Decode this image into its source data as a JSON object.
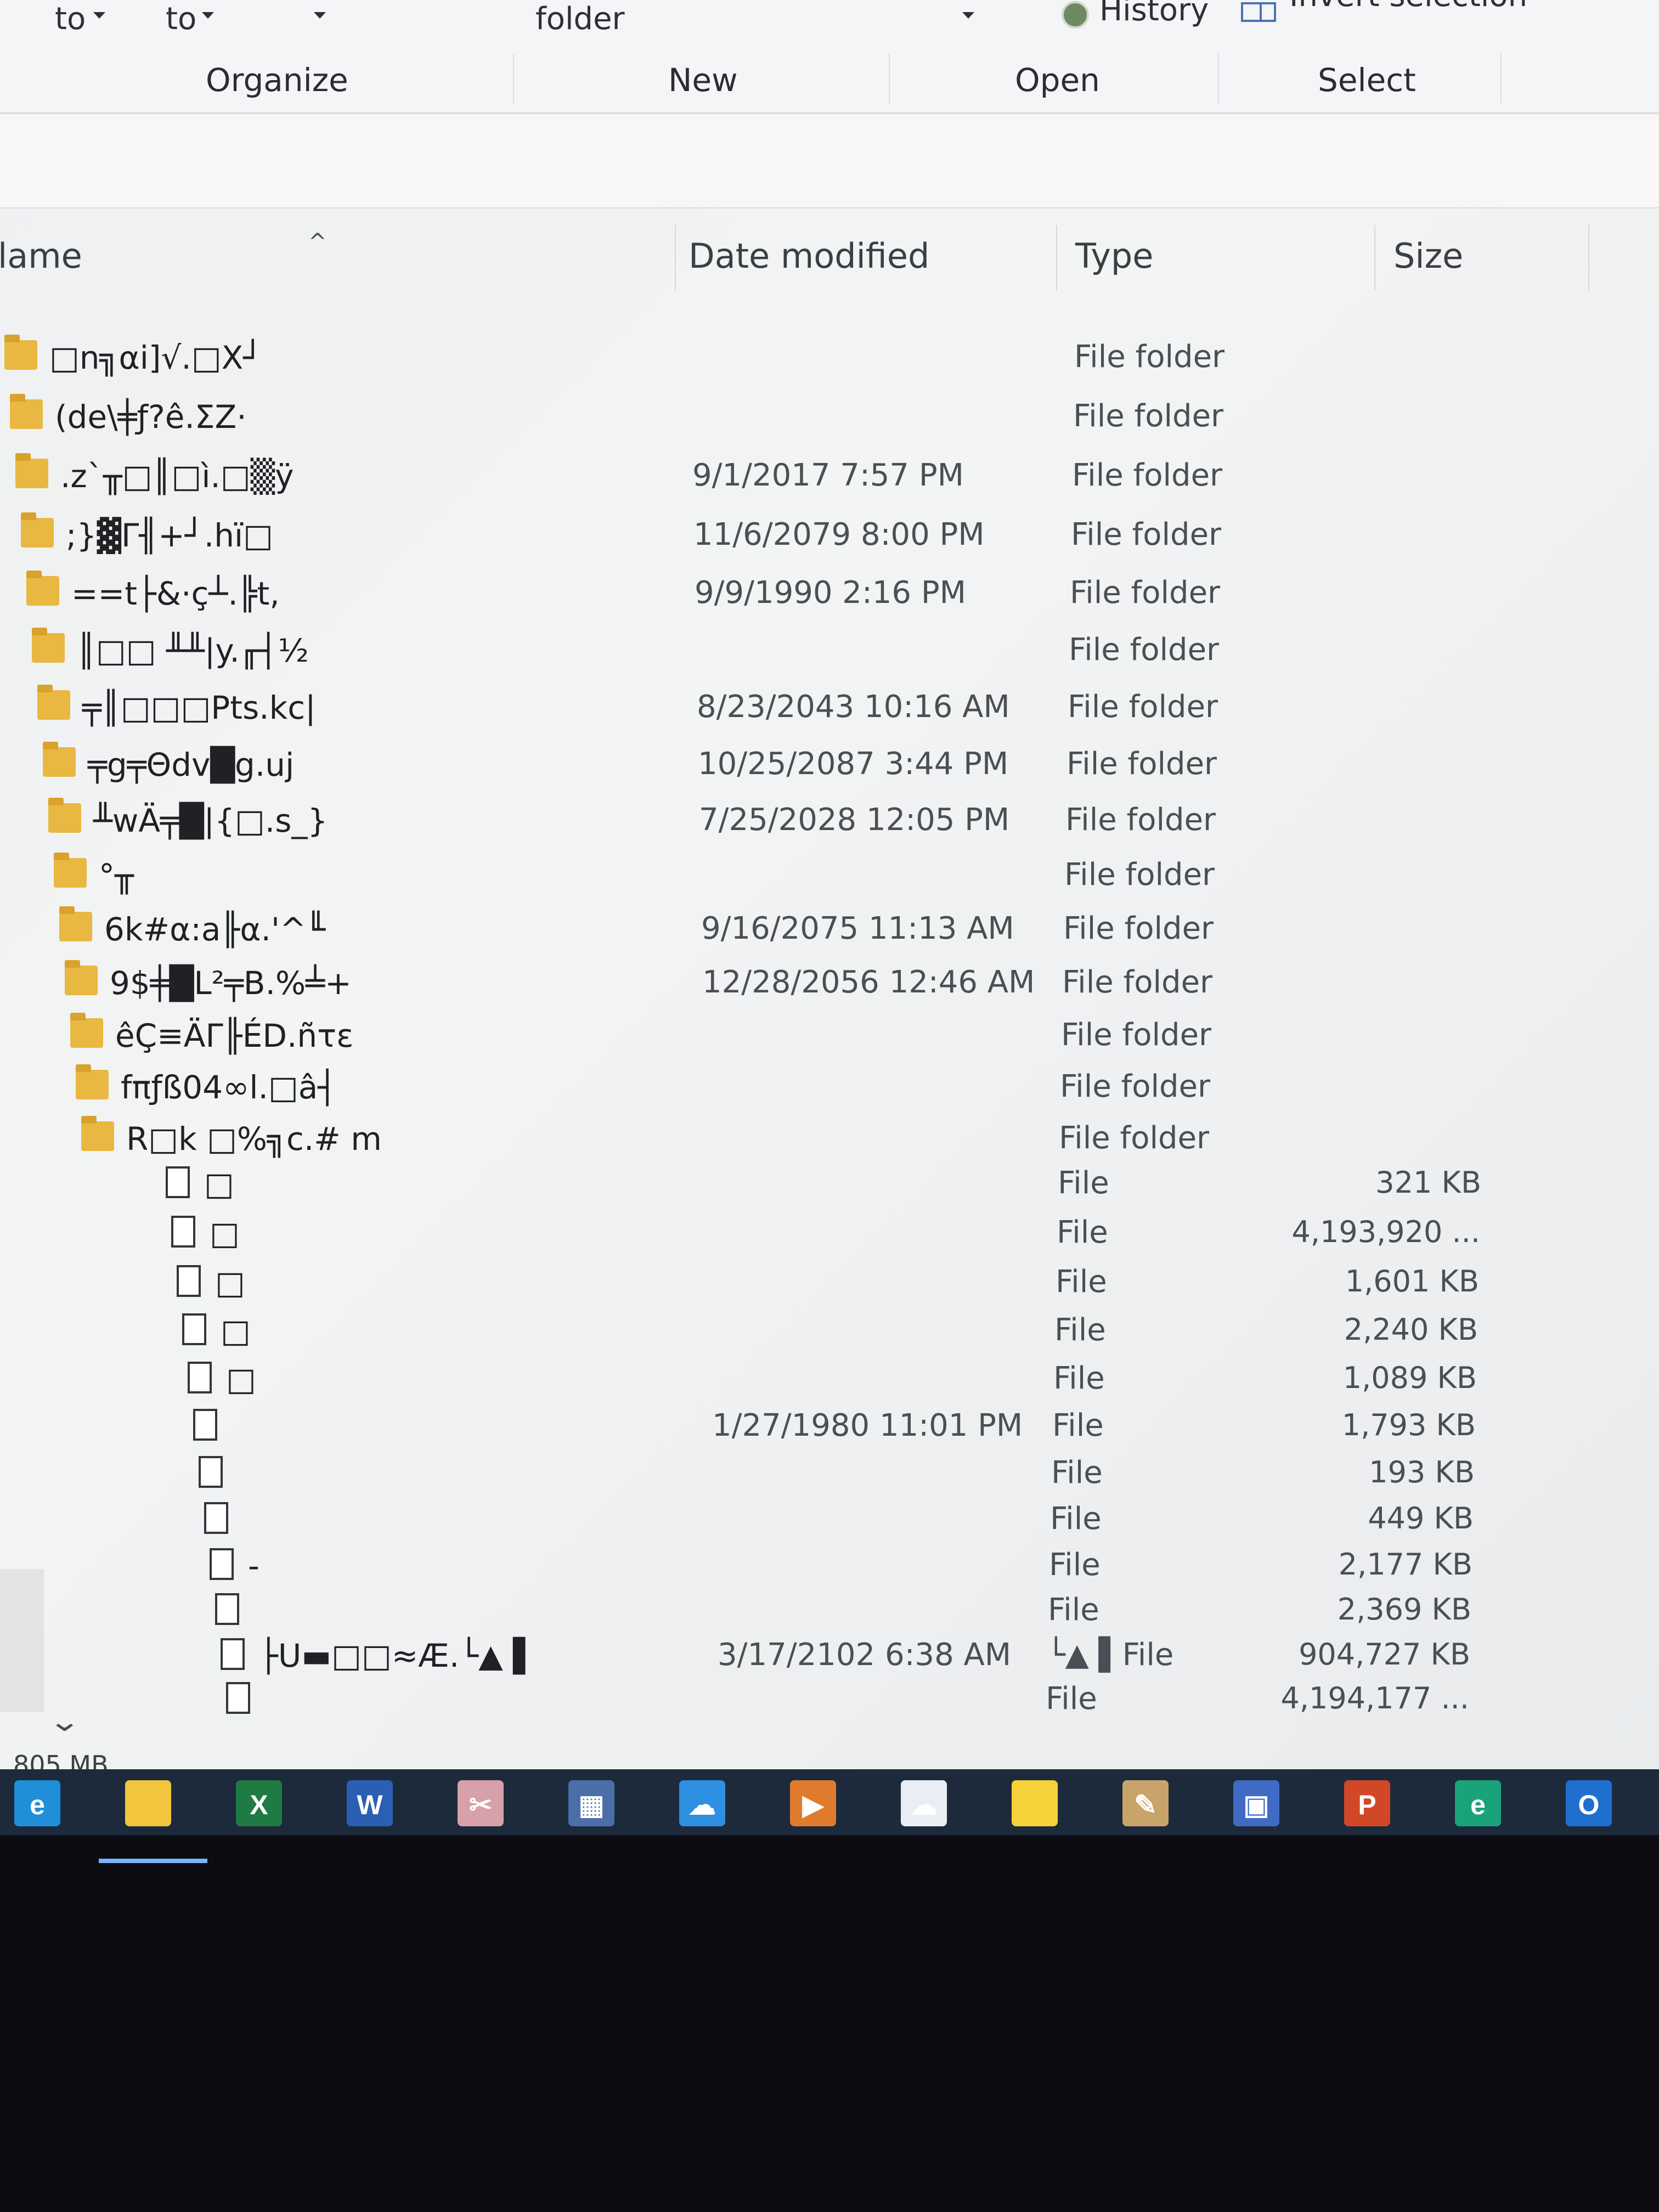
{
  "ribbon": {
    "top_left_1": "to",
    "top_left_2": "to",
    "folder_label": "folder",
    "history_label": "History",
    "invert_selection_label": "Invert selection",
    "groups": [
      "Organize",
      "New",
      "Open",
      "Select"
    ]
  },
  "columns": {
    "name": "lame",
    "date_modified": "Date modified",
    "type": "Type",
    "size": "Size"
  },
  "rows": [
    {
      "name": "□n╗αi]√.□X┘",
      "date": "",
      "type": "File folder",
      "size": "",
      "icon": "folder-icon"
    },
    {
      "name": "(de\\╪ƒ?ê.ΣZ·",
      "date": "",
      "type": "File folder",
      "size": "",
      "icon": "folder-icon"
    },
    {
      "name": ".z`╥□║□ì.□▒ÿ",
      "date": "9/1/2017 7:57 PM",
      "type": "File folder",
      "size": "",
      "icon": "folder-icon"
    },
    {
      "name": ";}▓Γ╢+┘.hï□",
      "date": "11/6/2079 8:00 PM",
      "type": "File folder",
      "size": "",
      "icon": "folder-icon"
    },
    {
      "name": "==t├&·ç┴.╠t,",
      "date": "9/9/1990 2:16 PM",
      "type": "File folder",
      "size": "",
      "icon": "folder-icon"
    },
    {
      "name": "║□□ ╨╨|y.╓┤½",
      "date": "",
      "type": "File folder",
      "size": "",
      "icon": "folder-icon"
    },
    {
      "name": "╤║□□□Pts.kc|",
      "date": "8/23/2043 10:16 AM",
      "type": "File folder",
      "size": "",
      "icon": "folder-icon"
    },
    {
      "name": "╤g╤Θdv█g.uj",
      "date": "10/25/2087 3:44 PM",
      "type": "File folder",
      "size": "",
      "icon": "folder-icon"
    },
    {
      "name": "╨wÄ╤█|{□.s_}",
      "date": "7/25/2028 12:05 PM",
      "type": "File folder",
      "size": "",
      "icon": "folder-icon"
    },
    {
      "name": "°╥",
      "date": "",
      "type": "File folder",
      "size": "",
      "icon": "folder-icon"
    },
    {
      "name": "6k#α:a╟α.'^╙",
      "date": "9/16/2075 11:13 AM",
      "type": "File folder",
      "size": "",
      "icon": "folder-icon"
    },
    {
      "name": "9$╪█L²╤B.%╧+",
      "date": "12/28/2056 12:46 AM",
      "type": "File folder",
      "size": "",
      "icon": "folder-icon"
    },
    {
      "name": "êÇ≡ÄΓ╟ÉD.ñτε",
      "date": "",
      "type": "File folder",
      "size": "",
      "icon": "folder-icon"
    },
    {
      "name": "fπƒß04∞l.□â┤",
      "date": "",
      "type": "File folder",
      "size": "",
      "icon": "folder-icon"
    },
    {
      "name": "R□k □%╗c.# m",
      "date": "",
      "type": "File folder",
      "size": "",
      "icon": "folder-icon"
    },
    {
      "name": "□",
      "date": "",
      "type": "File",
      "size": "321 KB",
      "icon": "file-icon"
    },
    {
      "name": "□",
      "date": "",
      "type": "File",
      "size": "4,193,920 ...",
      "icon": "file-icon"
    },
    {
      "name": "□",
      "date": "",
      "type": "File",
      "size": "1,601 KB",
      "icon": "file-icon"
    },
    {
      "name": "□",
      "date": "",
      "type": "File",
      "size": "2,240 KB",
      "icon": "file-icon"
    },
    {
      "name": "□",
      "date": "",
      "type": "File",
      "size": "1,089 KB",
      "icon": "file-icon"
    },
    {
      "name": "",
      "date": "1/27/1980 11:01 PM",
      "type": "File",
      "size": "1,793 KB",
      "icon": "file-icon"
    },
    {
      "name": "",
      "date": "",
      "type": "File",
      "size": "193 KB",
      "icon": "file-icon"
    },
    {
      "name": "",
      "date": "",
      "type": "File",
      "size": "449 KB",
      "icon": "file-icon"
    },
    {
      "name": "-",
      "date": "",
      "type": "File",
      "size": "2,177 KB",
      "icon": "file-icon"
    },
    {
      "name": "",
      "date": "",
      "type": "File",
      "size": "2,369 KB",
      "icon": "file-icon"
    },
    {
      "name": "├U▬□□≈Æ.└▲ ▌",
      "date": "3/17/2102 6:38 AM",
      "type": "└▲ ▌File",
      "size": "904,727 KB",
      "icon": "file-icon"
    },
    {
      "name": "",
      "date": "",
      "type": "File",
      "size": "4,194,177 ...",
      "icon": "file-icon"
    }
  ],
  "status_bar": {
    "text": "805 MB"
  },
  "taskbar": {
    "items": [
      {
        "name": "internet-explorer-icon",
        "label": "e",
        "color": "#1e8fd8"
      },
      {
        "name": "file-explorer-icon",
        "label": "",
        "color": "#f2c53d"
      },
      {
        "name": "excel-icon",
        "label": "X",
        "color": "#1f7a44"
      },
      {
        "name": "word-icon",
        "label": "W",
        "color": "#2b5fb3"
      },
      {
        "name": "snipping-tool-icon",
        "label": "✂",
        "color": "#d8a0a8"
      },
      {
        "name": "calculator-icon",
        "label": "▦",
        "color": "#4b6ea9"
      },
      {
        "name": "onedrive-icon",
        "label": "☁",
        "color": "#2f8fe0"
      },
      {
        "name": "media-player-icon",
        "label": "▶",
        "color": "#e07b2d"
      },
      {
        "name": "cloud-app-icon",
        "label": "☁",
        "color": "#e9eef5"
      },
      {
        "name": "sticky-notes-icon",
        "label": "",
        "color": "#f5d23a"
      },
      {
        "name": "paint-icon",
        "label": "✎",
        "color": "#c9a46a"
      },
      {
        "name": "remote-desktop-icon",
        "label": "▣",
        "color": "#3f6bc4"
      },
      {
        "name": "powerpoint-icon",
        "label": "P",
        "color": "#d24726"
      },
      {
        "name": "edge-icon",
        "label": "e",
        "color": "#1aa37a"
      },
      {
        "name": "outlook-icon",
        "label": "O",
        "color": "#1f6fd1"
      }
    ]
  }
}
